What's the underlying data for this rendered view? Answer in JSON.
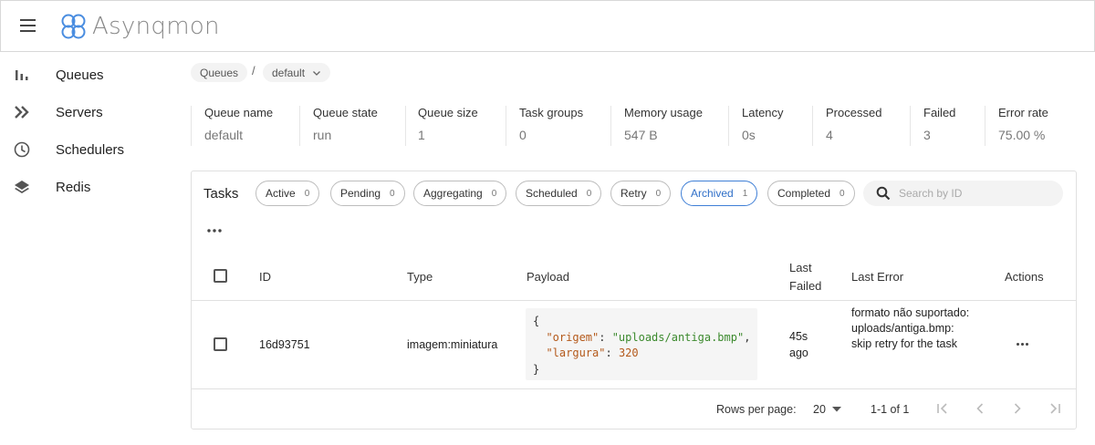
{
  "app": {
    "title": "Asynqmon",
    "menu_icon": "hamburger-menu-icon",
    "logo_icon": "asynqmon-logo-icon"
  },
  "sidebar": {
    "items": [
      {
        "label": "Queues",
        "icon": "bar-chart-icon"
      },
      {
        "label": "Servers",
        "icon": "double-chevron-right-icon"
      },
      {
        "label": "Schedulers",
        "icon": "clock-icon"
      },
      {
        "label": "Redis",
        "icon": "layers-icon"
      }
    ]
  },
  "breadcrumb": {
    "root": "Queues",
    "separator": "/",
    "current": "default"
  },
  "stats": [
    {
      "label": "Queue name",
      "value": "default"
    },
    {
      "label": "Queue state",
      "value": "run"
    },
    {
      "label": "Queue size",
      "value": "1"
    },
    {
      "label": "Task groups",
      "value": "0"
    },
    {
      "label": "Memory usage",
      "value": "547 B"
    },
    {
      "label": "Latency",
      "value": "0s"
    },
    {
      "label": "Processed",
      "value": "4"
    },
    {
      "label": "Failed",
      "value": "3"
    },
    {
      "label": "Error rate",
      "value": "75.00 %"
    }
  ],
  "tasks": {
    "title": "Tasks",
    "tabs": [
      {
        "label": "Active",
        "count": "0"
      },
      {
        "label": "Pending",
        "count": "0"
      },
      {
        "label": "Aggregating",
        "count": "0"
      },
      {
        "label": "Scheduled",
        "count": "0"
      },
      {
        "label": "Retry",
        "count": "0"
      },
      {
        "label": "Archived",
        "count": "1",
        "selected": true
      },
      {
        "label": "Completed",
        "count": "0"
      }
    ],
    "search": {
      "placeholder": "Search by ID",
      "value": ""
    },
    "accent_color": "#3f7fd6"
  },
  "table": {
    "headers": {
      "id": "ID",
      "type": "Type",
      "payload": "Payload",
      "last_failed_1": "Last",
      "last_failed_2": "Failed",
      "last_error": "Last Error",
      "actions": "Actions"
    },
    "rows": [
      {
        "id": "16d93751",
        "type": "imagem:miniatura",
        "payload": {
          "open": "{",
          "k1": "\"origem\"",
          "v1": "\"uploads/antiga.bmp\"",
          "k2": "\"largura\"",
          "v2": "320",
          "close": "}"
        },
        "last_failed_1": "45s",
        "last_failed_2": "ago",
        "last_error": "formato não suportado: uploads/antiga.bmp: skip retry for the task"
      }
    ]
  },
  "pagination": {
    "rows_per_page_label": "Rows per page:",
    "rows_per_page": "20",
    "range": "1-1 of 1"
  }
}
